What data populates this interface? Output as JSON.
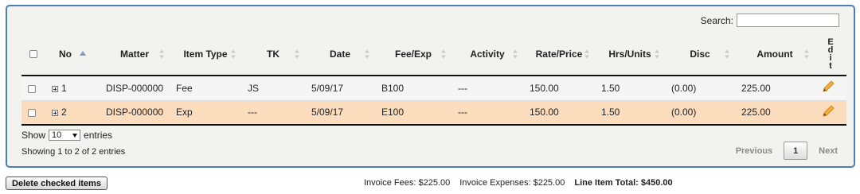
{
  "search": {
    "label": "Search:",
    "value": ""
  },
  "table": {
    "columns": [
      "No",
      "Matter",
      "Item Type",
      "TK",
      "Date",
      "Fee/Exp",
      "Activity",
      "Rate/Price",
      "Hrs/Units",
      "Disc",
      "Amount",
      "Edit"
    ],
    "rows": [
      {
        "no": "1",
        "matter": "DISP-000000",
        "item_type": "Fee",
        "tk": "JS",
        "date": "5/09/17",
        "fee_exp": "B100",
        "activity": "---",
        "rate": "150.00",
        "hrs": "1.50",
        "disc": "(0.00)",
        "amount": "225.00"
      },
      {
        "no": "2",
        "matter": "DISP-000000",
        "item_type": "Exp",
        "tk": "---",
        "date": "5/09/17",
        "fee_exp": "E100",
        "activity": "---",
        "rate": "150.00",
        "hrs": "1.50",
        "disc": "(0.00)",
        "amount": "225.00"
      }
    ]
  },
  "length": {
    "show": "Show",
    "value": "10",
    "entries": "entries"
  },
  "info": "Showing 1 to 2 of 2 entries",
  "pager": {
    "previous": "Previous",
    "current": "1",
    "next": "Next"
  },
  "delete_button": "Delete checked items",
  "totals": {
    "fees": "Invoice Fees: $225.00",
    "expenses": "Invoice Expenses: $225.00",
    "line_total": "Line Item Total: $450.00"
  },
  "colors": {
    "border": "#4a7fb3",
    "highlight_row": "#fbdcbd",
    "edit_icon": "#e8a33a"
  },
  "icons": [
    "checkbox",
    "expand-plus-icon",
    "sort-icon",
    "pencil-icon"
  ]
}
